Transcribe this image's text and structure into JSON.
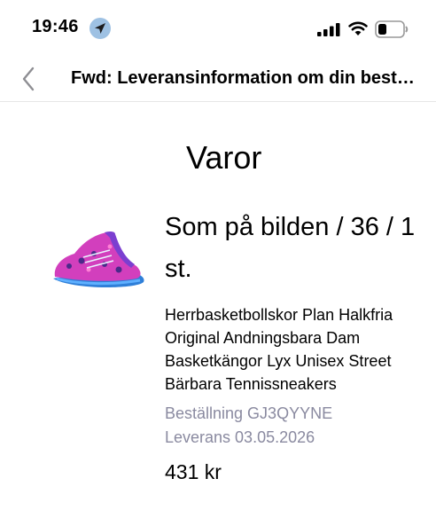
{
  "status_bar": {
    "time": "19:46",
    "icons": [
      "location-arrow-icon",
      "cellular-signal-icon",
      "wifi-icon",
      "battery-icon"
    ]
  },
  "nav": {
    "back_icon": "chevron-left-icon",
    "title": "Fwd: Leveransinformation om din beställning"
  },
  "content": {
    "section_title": "Varor",
    "product": {
      "image": "pink-basketball-sneaker",
      "name": "Som på bilden / 36 / 1 st.",
      "description": "Herrbasketbollskor Plan Halkfria Original Andningsbara Dam Basketkängor Lyx Unisex Street Bärbara Tennissneakers",
      "order_number": "Beställning GJ3QYYNE",
      "delivery": "Leverans 03.05.2026",
      "price": "431 kr"
    }
  },
  "colors": {
    "meta_text": "#8a8aa0",
    "location_badge": "#9ec1e3",
    "separator": "#e6e6e6"
  }
}
